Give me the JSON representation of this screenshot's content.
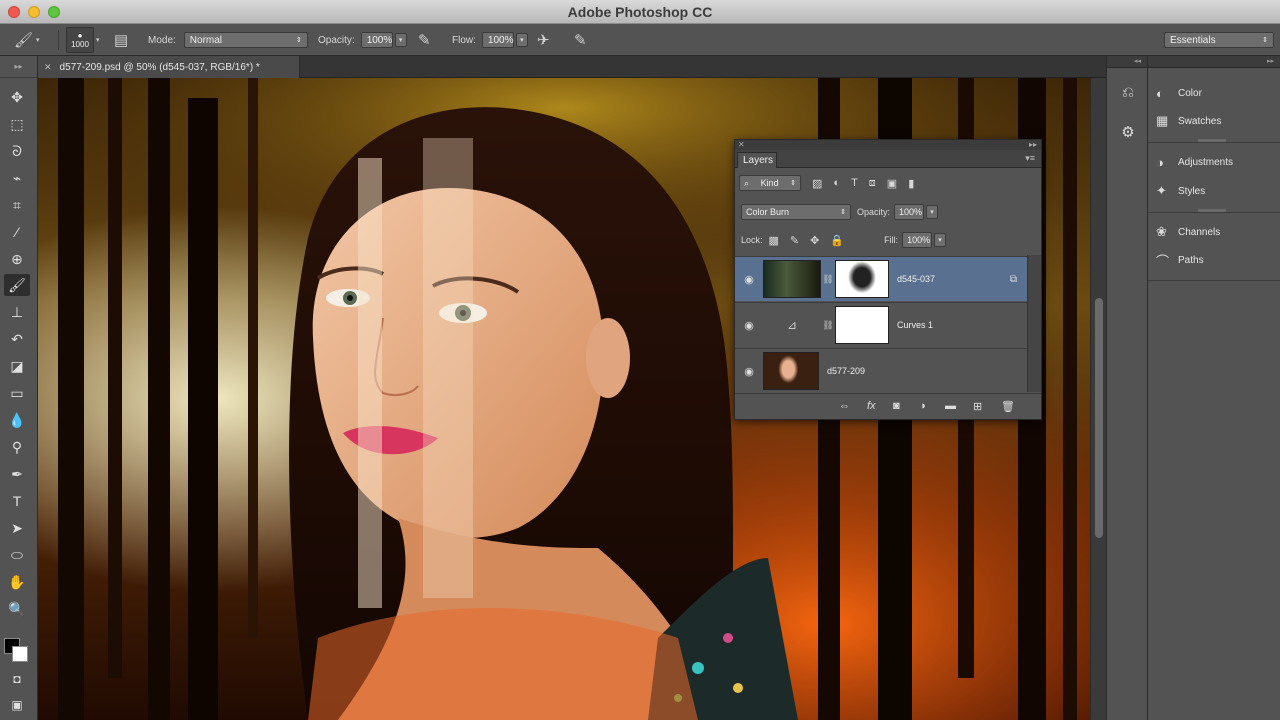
{
  "window": {
    "title": "Adobe Photoshop CC"
  },
  "options_bar": {
    "brush_size": "1000",
    "mode_label": "Mode:",
    "mode_value": "Normal",
    "opacity_label": "Opacity:",
    "opacity_value": "100%",
    "flow_label": "Flow:",
    "flow_value": "100%",
    "workspace": "Essentials"
  },
  "document_tab": {
    "label": "d577-209.psd @ 50% (d545-037, RGB/16*) *"
  },
  "tools": [
    "move-tool",
    "marquee-tool",
    "lasso-tool",
    "quick-select-tool",
    "crop-tool",
    "eyedropper-tool",
    "spot-heal-tool",
    "brush-tool",
    "clone-stamp-tool",
    "history-brush-tool",
    "eraser-tool",
    "gradient-tool",
    "blur-tool",
    "dodge-tool",
    "pen-tool",
    "type-tool",
    "path-select-tool",
    "ellipse-tool",
    "hand-tool",
    "zoom-tool"
  ],
  "right_panel": {
    "items": [
      {
        "label": "Color",
        "icon": "color-icon"
      },
      {
        "label": "Swatches",
        "icon": "swatches-icon"
      },
      {
        "label": "Adjustments",
        "icon": "adjustments-icon"
      },
      {
        "label": "Styles",
        "icon": "styles-icon"
      },
      {
        "label": "Channels",
        "icon": "channels-icon"
      },
      {
        "label": "Paths",
        "icon": "paths-icon"
      }
    ]
  },
  "layers_panel": {
    "tab": "Layers",
    "filter_kind": "Kind",
    "blend_mode": "Color Burn",
    "opacity_label": "Opacity:",
    "opacity_value": "100%",
    "lock_label": "Lock:",
    "fill_label": "Fill:",
    "fill_value": "100%",
    "layers": [
      {
        "name": "d545-037",
        "selected": true
      },
      {
        "name": "Curves 1",
        "selected": false
      },
      {
        "name": "d577-209",
        "selected": false
      }
    ]
  },
  "colors": {
    "selection": "#5a7090",
    "panel": "#535353",
    "foreground": "#000000",
    "background": "#ffffff"
  }
}
